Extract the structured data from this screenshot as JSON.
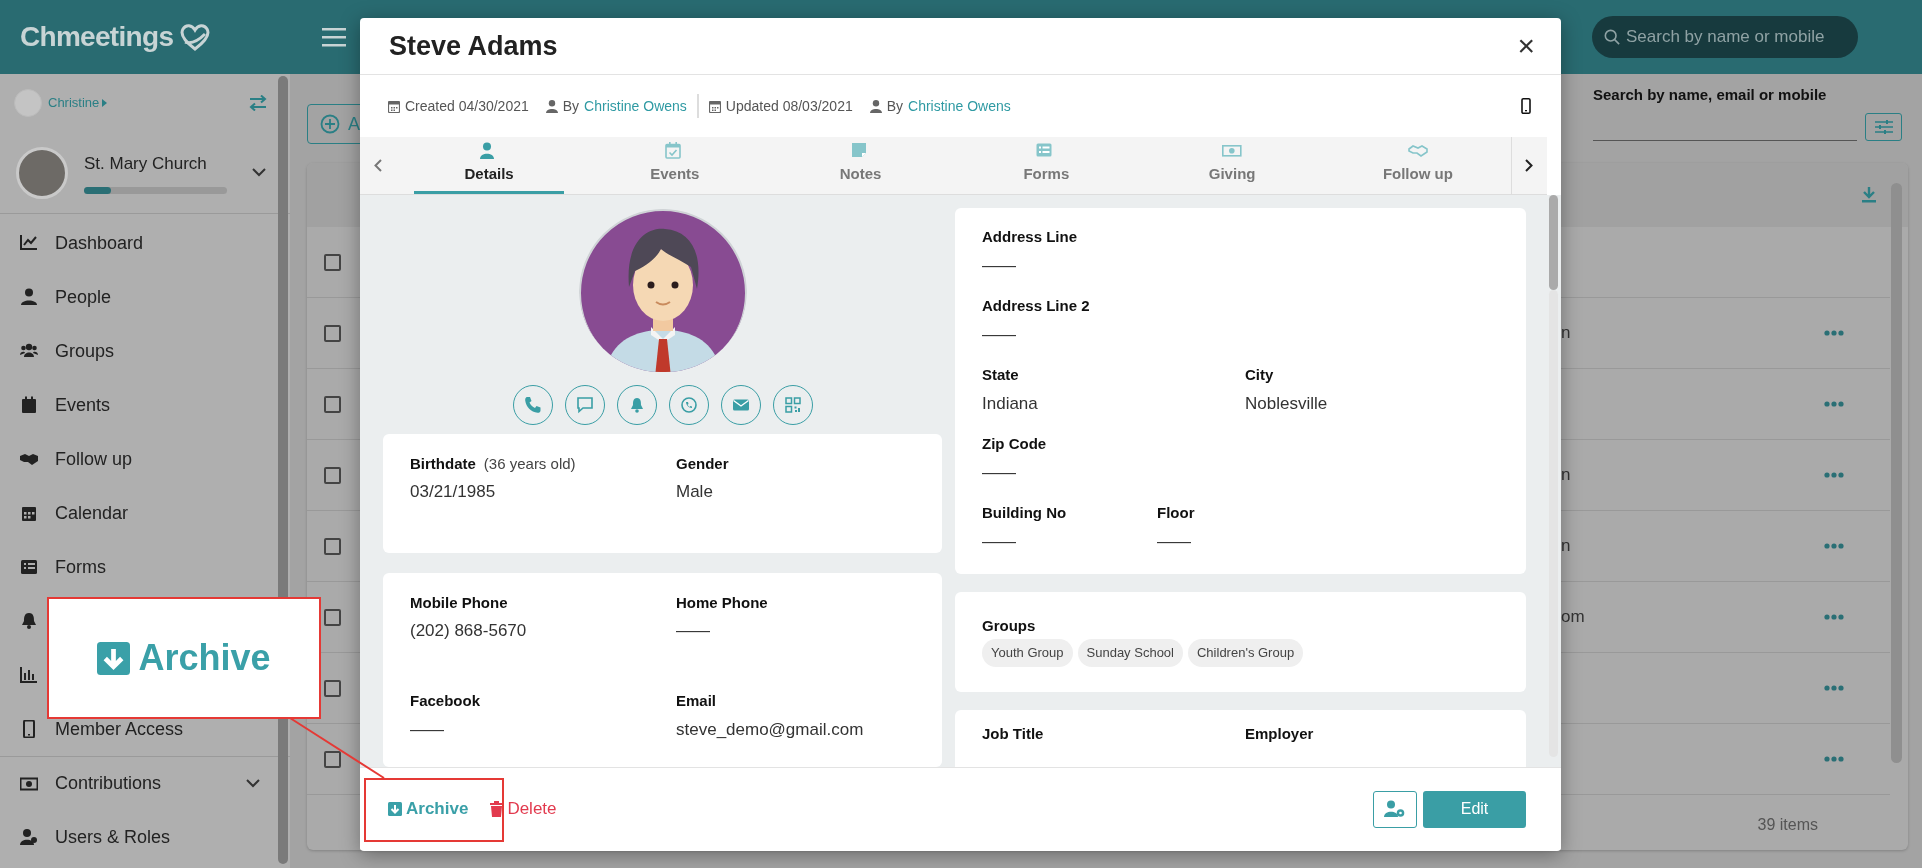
{
  "header": {
    "logo": "Chmeetings",
    "search_placeholder": "Search by name or mobile"
  },
  "sidebar": {
    "user": "Christine",
    "church": "St. Mary Church",
    "church_progress": {
      "level": 0.19
    },
    "items": [
      {
        "label": "Dashboard",
        "kind": "link"
      },
      {
        "label": "People",
        "kind": "link"
      },
      {
        "label": "Groups",
        "kind": "link"
      },
      {
        "label": "Events",
        "kind": "link"
      },
      {
        "label": "Follow up",
        "kind": "link"
      },
      {
        "label": "Calendar",
        "kind": "link"
      },
      {
        "label": "Forms",
        "kind": "link"
      },
      {
        "kind": "link"
      },
      {
        "kind": "link"
      },
      {
        "label": "Member Access",
        "kind": "link"
      },
      {
        "label": "Contributions",
        "expanded": false,
        "kind": "group"
      },
      {
        "label": "Users & Roles",
        "kind": "link"
      }
    ]
  },
  "content": {
    "add_button": "A",
    "search_label": "Search by name, email or mobile",
    "rows": [
      {
        "checked": false,
        "text": "",
        "menu": false
      },
      {
        "checked": false,
        "text": "n",
        "menu": true
      },
      {
        "checked": false,
        "text": "",
        "menu": true
      },
      {
        "checked": false,
        "text": "n",
        "menu": true
      },
      {
        "checked": false,
        "text": "n",
        "menu": true
      },
      {
        "checked": false,
        "text": "om",
        "menu": true
      },
      {
        "checked": false,
        "text": "",
        "menu": true
      },
      {
        "checked": false,
        "text": "",
        "menu": true
      }
    ],
    "footer": "39 items"
  },
  "modal": {
    "title": "Steve Adams",
    "close": "×",
    "meta": [
      {
        "kind": "date",
        "text": "Created 04/30/2021"
      },
      {
        "kind": "author",
        "prefix": "By",
        "name": "Christine Owens"
      },
      {
        "kind": "divider"
      },
      {
        "kind": "date",
        "text": "Updated 08/03/2021"
      },
      {
        "kind": "author",
        "prefix": "By",
        "name": "Christine Owens"
      }
    ],
    "tabs": [
      {
        "label": "Details",
        "selected": true
      },
      {
        "label": "Events",
        "selected": false
      },
      {
        "label": "Notes",
        "selected": false
      },
      {
        "label": "Forms",
        "selected": false
      },
      {
        "label": "Giving",
        "selected": false
      },
      {
        "label": "Follow up",
        "selected": false
      }
    ],
    "left_cards": [
      {
        "fields": [
          {
            "label": "Birthdate",
            "note": "(36 years old)",
            "value": "03/21/1985"
          },
          {
            "label": "Gender",
            "value": "Male"
          }
        ]
      },
      {
        "fields": [
          {
            "label": "Mobile Phone",
            "value": "(202) 868-5670"
          },
          {
            "label": "Home Phone",
            "value": "——"
          },
          {
            "label": "Facebook",
            "value": "——"
          },
          {
            "label": "Email",
            "value": "steve_demo@gmail.com"
          }
        ]
      }
    ],
    "address_rows": [
      {
        "kind": "wide",
        "fields": [
          {
            "label": "Address Line",
            "value": "——"
          }
        ]
      },
      {
        "kind": "wide",
        "fields": [
          {
            "label": "Address Line 2",
            "value": "——"
          }
        ]
      },
      {
        "kind": "wide",
        "fields": [
          {
            "label": "State",
            "value": "Indiana"
          },
          {
            "label": "City",
            "value": "Noblesville"
          }
        ]
      },
      {
        "kind": "wide",
        "fields": [
          {
            "label": "Zip Code",
            "value": "——"
          }
        ]
      },
      {
        "kind": "compact",
        "fields": [
          {
            "label": "Building No",
            "value": "——"
          },
          {
            "label": "Floor",
            "value": "——"
          }
        ]
      }
    ],
    "groups": {
      "label": "Groups",
      "tags": [
        "Youth Group",
        "Sunday School",
        "Children's Group"
      ]
    },
    "job_labels": [
      "Job Title",
      "Employer"
    ],
    "archive": "Archive",
    "delete": "Delete",
    "edit": "Edit"
  },
  "callout": {
    "label": "Archive"
  }
}
